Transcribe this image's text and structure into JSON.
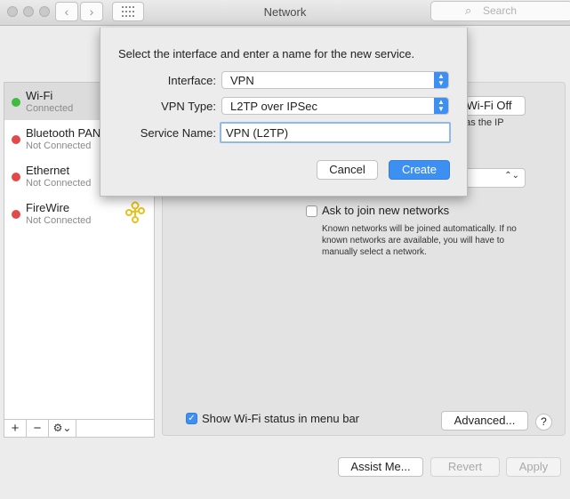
{
  "window": {
    "title": "Network"
  },
  "toolbar": {
    "search_placeholder": "Search"
  },
  "sidebar": {
    "items": [
      {
        "name": "Wi-Fi",
        "status": "Connected",
        "dot": "#3fbc3f"
      },
      {
        "name": "Bluetooth PAN",
        "status": "Not Connected",
        "dot": "#e24a4a"
      },
      {
        "name": "Ethernet",
        "status": "Not Connected",
        "dot": "#e24a4a"
      },
      {
        "name": "FireWire",
        "status": "Not Connected",
        "dot": "#e24a4a"
      }
    ],
    "tools": {
      "add": "+",
      "remove": "−",
      "action": "⚙⌄"
    }
  },
  "main": {
    "wifi_off_label": "Wi-Fi Off",
    "partial_text": "has the IP",
    "ask_label": "Ask to join new networks",
    "ask_desc": "Known networks will be joined automatically. If no known networks are available, you will have to manually select a network.",
    "show_status_label": "Show Wi-Fi status in menu bar",
    "advanced_label": "Advanced...",
    "help_label": "?"
  },
  "bottom": {
    "assist_label": "Assist Me...",
    "revert_label": "Revert",
    "apply_label": "Apply"
  },
  "sheet": {
    "prompt": "Select the interface and enter a name for the new service.",
    "interface_label": "Interface:",
    "interface_value": "VPN",
    "vpn_type_label": "VPN Type:",
    "vpn_type_value": "L2TP over IPSec",
    "service_name_label": "Service Name:",
    "service_name_value": "VPN (L2TP)",
    "cancel_label": "Cancel",
    "create_label": "Create"
  },
  "colors": {
    "accent": "#3d8ff2",
    "connected": "#3fbc3f",
    "disconnected": "#e24a4a"
  }
}
